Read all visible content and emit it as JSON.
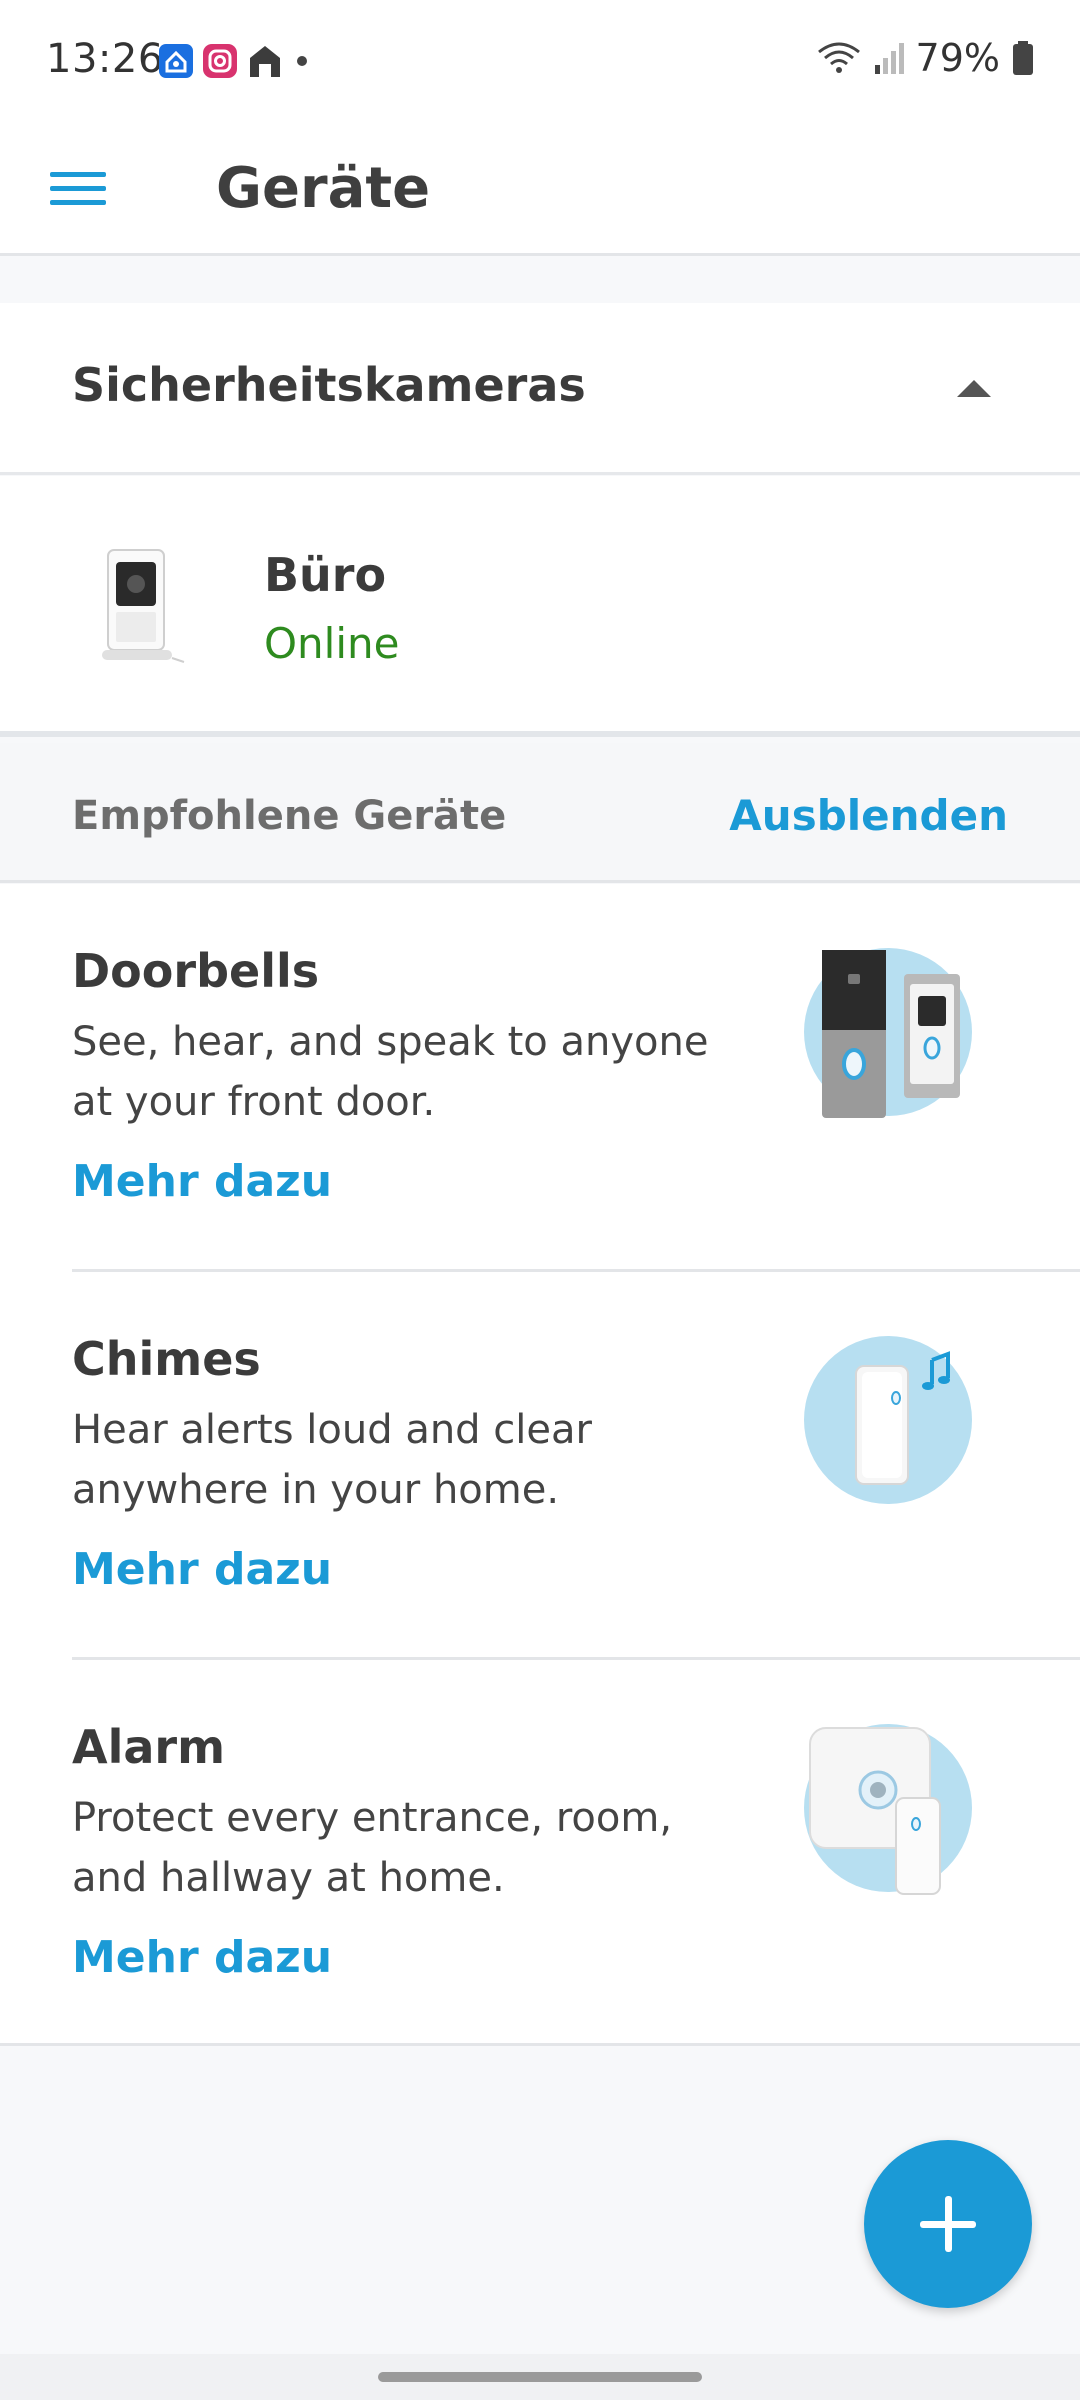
{
  "status_bar": {
    "time": "13:26",
    "battery": "79%",
    "icons": [
      "smart-home-icon",
      "instagram-icon",
      "ring-home-icon",
      "notification-dot-icon",
      "wifi-icon",
      "signal-icon",
      "battery-icon"
    ]
  },
  "app_bar": {
    "title": "Geräte",
    "menu_icon": "hamburger-menu-icon"
  },
  "section": {
    "title": "Sicherheitskameras",
    "expanded_icon": "caret-up-icon"
  },
  "devices": [
    {
      "name": "Büro",
      "status": "Online",
      "status_color": "#2e8b1f",
      "icon": "indoor-camera-icon"
    }
  ],
  "recommended": {
    "title": "Empfohlene Geräte",
    "hide_label": "Ausblenden",
    "items": [
      {
        "name": "Doorbells",
        "description": "See, hear, and speak to anyone at your front door.",
        "link": "Mehr dazu",
        "icon": "doorbell-illustration"
      },
      {
        "name": "Chimes",
        "description": "Hear alerts loud and clear anywhere in your home.",
        "link": "Mehr dazu",
        "icon": "chime-illustration"
      },
      {
        "name": "Alarm",
        "description": "Protect every entrance, room, and hallway at home.",
        "link": "Mehr dazu",
        "icon": "alarm-illustration"
      }
    ]
  },
  "fab": {
    "icon": "plus-icon"
  },
  "colors": {
    "accent": "#1b9ad6",
    "online": "#2e8b1f",
    "illustration_bg": "#b7dff1"
  }
}
